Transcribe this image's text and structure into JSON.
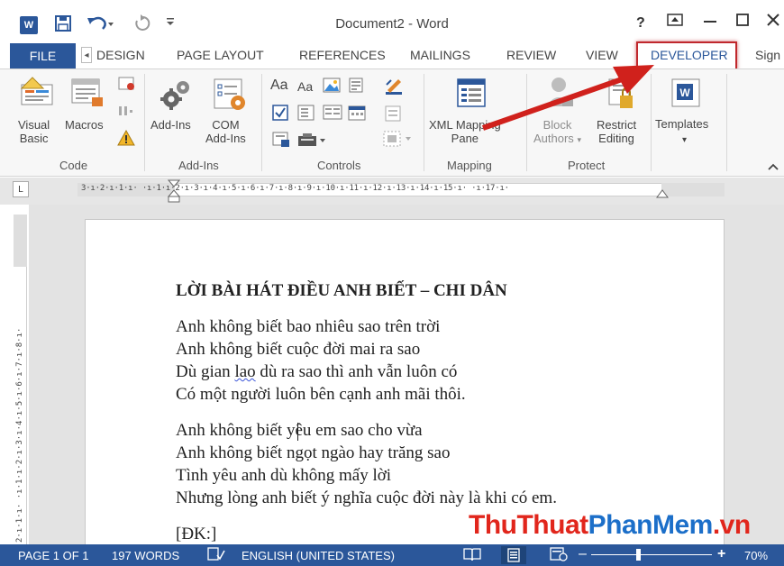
{
  "app": {
    "title": "Document2 - Word",
    "icon_letter": "W"
  },
  "quick_access": {
    "save_icon": "save-icon",
    "undo_icon": "undo-icon",
    "redo_icon": "redo-icon",
    "customize_icon": "customize-qat-icon"
  },
  "window_controls": {
    "help": "?",
    "ribbon_display": "⊡",
    "minimize": "—",
    "maximize": "☐",
    "close": "✕"
  },
  "tabs": {
    "file": "FILE",
    "items": [
      "DESIGN",
      "PAGE LAYOUT",
      "REFERENCES",
      "MAILINGS",
      "REVIEW",
      "VIEW",
      "DEVELOPER"
    ],
    "sign_in": "Sign"
  },
  "ribbon": {
    "code": {
      "label": "Code",
      "visual_basic": [
        "Visual",
        "Basic"
      ],
      "macros": "Macros"
    },
    "addins": {
      "label": "Add-Ins",
      "addins": "Add-Ins",
      "com_addins": [
        "COM",
        "Add-Ins"
      ]
    },
    "controls": {
      "label": "Controls",
      "rich_text": "Aa",
      "plain_text": "Aa"
    },
    "mapping": {
      "label": "Mapping",
      "xml_mapping": [
        "XML Mapping",
        "Pane"
      ]
    },
    "protect": {
      "label": "Protect",
      "block_authors": [
        "Block",
        "Authors"
      ],
      "restrict_editing": [
        "Restrict",
        "Editing"
      ]
    },
    "templates": {
      "label": "Templates"
    }
  },
  "ruler": {
    "horizontal": "3·ı·2·ı·1·ı·  ·ı·1·ı·2·ı·3·ı·4·ı·5·ı·6·ı·7·ı·8·ı·9·ı·10·ı·11·ı·12·ı·13·ı·14·ı·15·ı·  ·ı·17·ı·",
    "vertical": "2·ı·1·ı·  ·ı·1·ı·2·ı·3·ı·4·ı·5·ı·6·ı·7·ı·8·ı·",
    "corner": "L"
  },
  "document": {
    "title": "LỜI BÀI HÁT ĐIỀU ANH BIẾT – CHI DÂN",
    "verse1": [
      "Anh không biết bao nhiêu sao trên trời",
      "Anh không biết cuộc đời mai ra sao"
    ],
    "verse1_line3_a": "Dù gian ",
    "verse1_line3_b": "lao",
    "verse1_line3_c": " dù ra sao thì anh vẫn luôn có",
    "verse1_line4": "Có một người luôn bên cạnh anh mãi thôi.",
    "verse2": [
      "Anh không biết yêu em sao cho vừa",
      "Anh không biết ngọt ngào hay trăng sao",
      "Tình yêu anh dù không mấy lời",
      "Nhưng lòng anh biết ý nghĩa cuộc đời này là khi có em."
    ],
    "chorus": "[ĐK:]"
  },
  "watermark": {
    "part1": "ThuThuat",
    "part2": "PhanMem",
    "part3": ".vn"
  },
  "status": {
    "page": "PAGE 1 OF 1",
    "words": "197 WORDS",
    "language": "ENGLISH (UNITED STATES)",
    "zoom_minus": "–",
    "zoom_plus": "+",
    "zoom": "70%"
  },
  "colors": {
    "accent": "#2b579a",
    "highlight_box": "#c0282d",
    "arrow": "#d0211c"
  }
}
